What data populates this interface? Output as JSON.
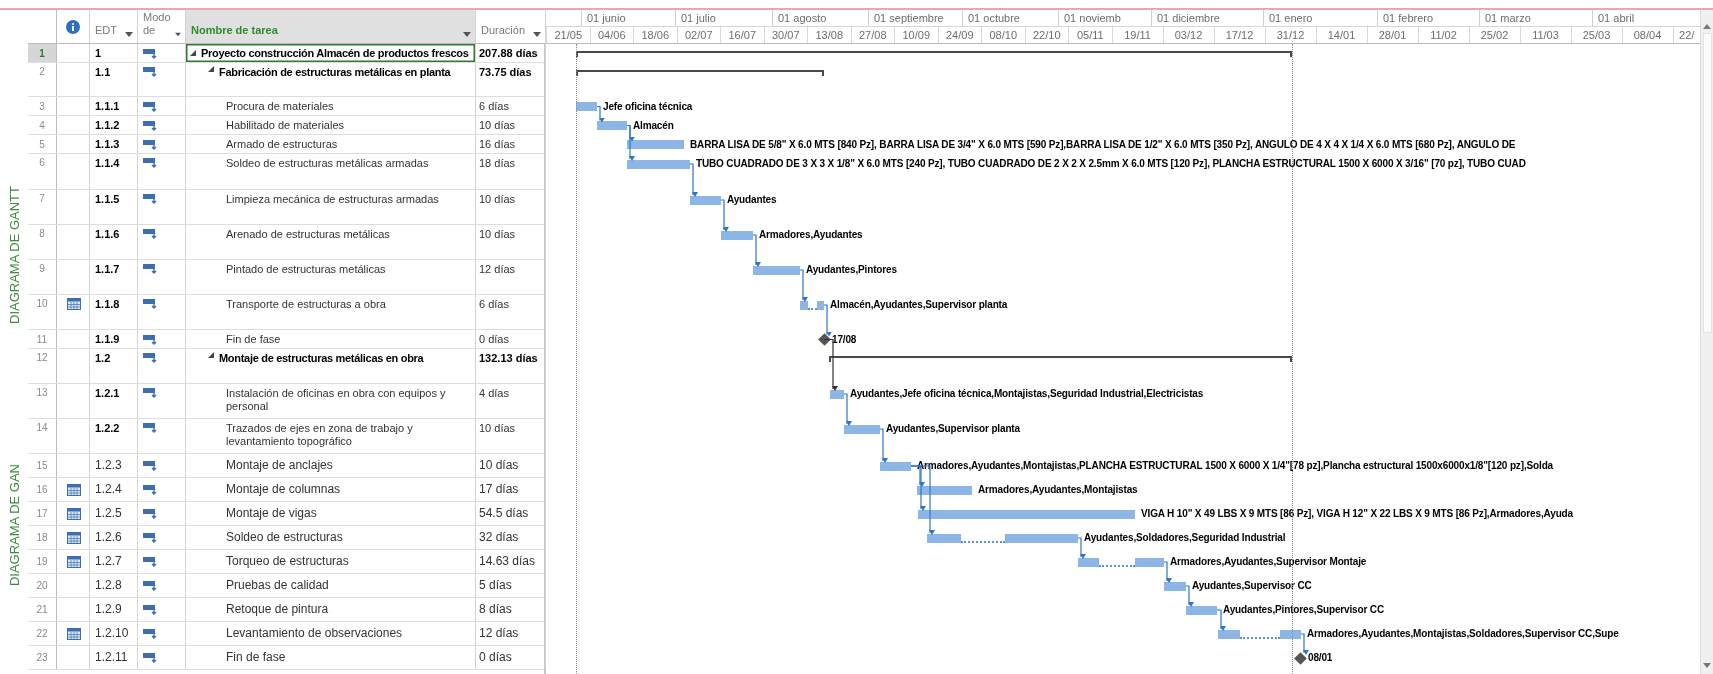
{
  "side_tabs": [
    "DIAGRAMA DE GANTT",
    "DIAGRAMA DE GAN"
  ],
  "columns": [
    {
      "kind": "info",
      "selected": false
    },
    {
      "kind": "text",
      "label": "EDT",
      "selected": false
    },
    {
      "kind": "text",
      "label": "Modo de",
      "selected": false
    },
    {
      "kind": "text",
      "label": "Nombre de tarea",
      "selected": true
    },
    {
      "kind": "text",
      "label": "Duración",
      "selected": false
    }
  ],
  "timescale": {
    "months": [
      "01 junio",
      "01 julio",
      "01 agosto",
      "01 septiembre",
      "01 octubre",
      "01 noviemb",
      "01 diciembre",
      "01 enero",
      "01 febrero",
      "01 marzo",
      "01 abril"
    ],
    "weeks": [
      "21/05",
      "04/06",
      "18/06",
      "02/07",
      "16/07",
      "30/07",
      "13/08",
      "27/08",
      "10/09",
      "24/09",
      "08/10",
      "22/10",
      "05/11",
      "19/11",
      "03/12",
      "17/12",
      "31/12",
      "14/01",
      "28/01",
      "11/02",
      "25/02",
      "11/03",
      "25/03",
      "08/04",
      "22/"
    ]
  },
  "tasks": [
    {
      "row": "1",
      "wbs": "1",
      "name": "Proyecto construcción Almacén de productos frescos",
      "duration": "207.88 días",
      "kind": "summary",
      "selected": true,
      "calendar": false,
      "expanded": true,
      "children": [
        {
          "row": "2",
          "wbs": "1.1",
          "name": "Fabricación de estructuras metálicas en planta",
          "duration": "73.75 días",
          "kind": "summary",
          "selected": false,
          "calendar": false,
          "expanded": true,
          "children": [
            {
              "row": "3",
              "wbs": "1.1.1",
              "name": "Procura de materiales",
              "duration": "6 días",
              "kind": "task",
              "selected": false,
              "calendar": false,
              "bar_label": "Jefe oficina técnica"
            },
            {
              "row": "4",
              "wbs": "1.1.2",
              "name": "Habilitado de materiales",
              "duration": "10 días",
              "kind": "task",
              "selected": false,
              "calendar": false,
              "bar_label": "Almacén"
            },
            {
              "row": "5",
              "wbs": "1.1.3",
              "name": "Armado de estructuras",
              "duration": "16 días",
              "kind": "task",
              "selected": false,
              "calendar": false,
              "bar_label": "BARRA LISA DE 5/8\" X 6.0 MTS [840 Pz], BARRA LISA DE 3/4\" X 6.0 MTS [590 Pz],BARRA LISA DE 1/2\" X 6.0 MTS [350 Pz], ANGULO DE 4 X 4 X 1/4 X 6.0 MTS [680 Pz], ANGULO DE"
            },
            {
              "row": "6",
              "wbs": "1.1.4",
              "name": "Soldeo de estructuras metálicas armadas",
              "duration": "18 días",
              "kind": "task",
              "selected": false,
              "calendar": false,
              "bar_label": "TUBO CUADRADO DE 3 X 3 X 1/8\" X 6.0 MTS [240 Pz], TUBO CUADRADO DE 2 X 2 X 2.5mm X 6.0 MTS [120 Pz], PLANCHA ESTRUCTURAL 1500 X 6000 X 3/16\" [70 pz], TUBO CUAD"
            },
            {
              "row": "7",
              "wbs": "1.1.5",
              "name": "Limpieza mecánica de estructuras armadas",
              "duration": "10 días",
              "kind": "task",
              "selected": false,
              "calendar": false,
              "bar_label": "Ayudantes"
            },
            {
              "row": "8",
              "wbs": "1.1.6",
              "name": "Arenado de estructuras metálicas",
              "duration": "10 días",
              "kind": "task",
              "selected": false,
              "calendar": false,
              "bar_label": "Armadores,Ayudantes"
            },
            {
              "row": "9",
              "wbs": "1.1.7",
              "name": "Pintado de estructuras metálicas",
              "duration": "12 días",
              "kind": "task",
              "selected": false,
              "calendar": false,
              "bar_label": "Ayudantes,Pintores"
            },
            {
              "row": "10",
              "wbs": "1.1.8",
              "name": "Transporte de estructuras a obra",
              "duration": "6 días",
              "kind": "task",
              "selected": false,
              "calendar": true,
              "bar_label": "Almacén,Ayudantes,Supervisor planta"
            },
            {
              "row": "11",
              "wbs": "1.1.9",
              "name": "Fin de fase",
              "duration": "0 días",
              "kind": "milestone",
              "selected": false,
              "calendar": false,
              "bar_label": "17/08"
            }
          ]
        },
        {
          "row": "12",
          "wbs": "1.2",
          "name": "Montaje de estructuras metálicas en obra",
          "duration": "132.13 días",
          "kind": "summary",
          "selected": false,
          "calendar": false,
          "expanded": true,
          "children": [
            {
              "row": "13",
              "wbs": "1.2.1",
              "name": "Instalación de oficinas en obra con equipos y personal",
              "duration": "4 días",
              "kind": "task",
              "selected": false,
              "calendar": false,
              "bar_label": "Ayudantes,Jefe oficina técnica,Montajistas,Seguridad Industrial,Electricistas"
            },
            {
              "row": "14",
              "wbs": "1.2.2",
              "name": "Trazados de ejes en zona de trabajo y levantamiento topográfico",
              "duration": "10 días",
              "kind": "task",
              "selected": false,
              "calendar": false,
              "bar_label": "Ayudantes,Supervisor planta"
            },
            {
              "row": "15",
              "wbs": "1.2.3",
              "name": "Montaje de anclajes",
              "duration": "10 días",
              "kind": "task",
              "selected": false,
              "calendar": false,
              "bar_label": "Armadores,Ayudantes,Montajistas,PLANCHA ESTRUCTURAL 1500 X 6000 X 1/4\"[78 pz],Plancha estructural 1500x6000x1/8\"[120 pz],Solda"
            },
            {
              "row": "16",
              "wbs": "1.2.4",
              "name": "Montaje de columnas",
              "duration": "17 días",
              "kind": "task",
              "selected": false,
              "calendar": true,
              "bar_label": "Armadores,Ayudantes,Montajistas"
            },
            {
              "row": "17",
              "wbs": "1.2.5",
              "name": "Montaje de vigas",
              "duration": "54.5 días",
              "kind": "task",
              "selected": false,
              "calendar": true,
              "bar_label": "VIGA H 10\" X 49 LBS X 9 MTS [86 Pz], VIGA H 12\" X 22 LBS X 9 MTS [86 Pz],Armadores,Ayuda"
            },
            {
              "row": "18",
              "wbs": "1.2.6",
              "name": "Soldeo de estructuras",
              "duration": "32 días",
              "kind": "task",
              "selected": false,
              "calendar": true,
              "bar_label": "Ayudantes,Soldadores,Seguridad Industrial"
            },
            {
              "row": "19",
              "wbs": "1.2.7",
              "name": "Torqueo de estructuras",
              "duration": "14.63 días",
              "kind": "task",
              "selected": false,
              "calendar": true,
              "bar_label": "Armadores,Ayudantes,Supervisor Montaje"
            },
            {
              "row": "20",
              "wbs": "1.2.8",
              "name": "Pruebas de calidad",
              "duration": "5 días",
              "kind": "task",
              "selected": false,
              "calendar": false,
              "bar_label": "Ayudantes,Supervisor CC"
            },
            {
              "row": "21",
              "wbs": "1.2.9",
              "name": "Retoque de pintura",
              "duration": "8 días",
              "kind": "task",
              "selected": false,
              "calendar": false,
              "bar_label": "Ayudantes,Pintores,Supervisor CC"
            },
            {
              "row": "22",
              "wbs": "1.2.10",
              "name": "Levantamiento de observaciones",
              "duration": "12 días",
              "kind": "task",
              "selected": false,
              "calendar": true,
              "bar_label": "Armadores,Ayudantes,Montajistas,Soldadores,Supervisor CC,Supe"
            },
            {
              "row": "23",
              "wbs": "1.2.11",
              "name": "Fin de fase",
              "duration": "0 días",
              "kind": "milestone",
              "selected": false,
              "calendar": false,
              "bar_label": "08/01"
            }
          ]
        }
      ]
    }
  ]
}
